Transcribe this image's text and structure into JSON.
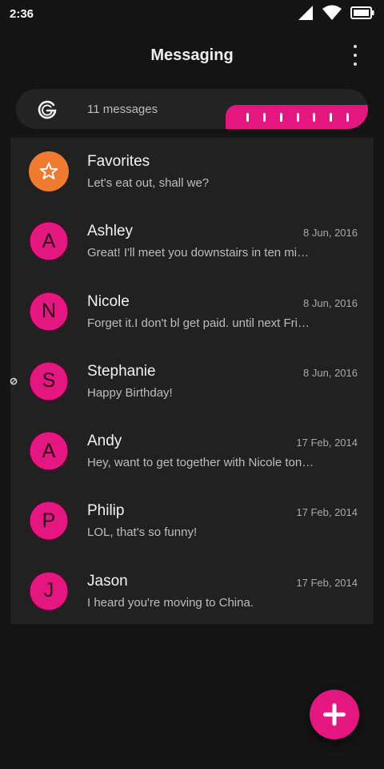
{
  "status_bar": {
    "time": "2:36",
    "icons": [
      "signal-icon",
      "wifi-icon",
      "battery-icon"
    ]
  },
  "app_bar": {
    "title": "Messaging",
    "menu_icon": "more-vert-icon"
  },
  "summary": {
    "icon": "g-logo-icon",
    "count_text": "11 messages"
  },
  "colors": {
    "accent": "#e3177f",
    "favorite": "#f07a30",
    "background": "#141414",
    "list_background": "#212121"
  },
  "conversations": [
    {
      "initial": "",
      "icon": "star-icon",
      "name": "Favorites",
      "date": "",
      "preview": "Let's eat out, shall we?"
    },
    {
      "initial": "A",
      "name": "Ashley",
      "date": "8 Jun, 2016",
      "preview": "Great! I'll meet you downstairs in ten minutes."
    },
    {
      "initial": "N",
      "name": "Nicole",
      "date": "8 Jun, 2016",
      "preview": "Forget it.I don't bl get paid. until next Friday."
    },
    {
      "initial": "S",
      "name": "Stephanie",
      "date": "8 Jun, 2016",
      "preview": "Happy Birthday!"
    },
    {
      "initial": "A",
      "name": "Andy",
      "date": "17 Feb, 2014",
      "preview": "Hey, want to get together with Nicole tonight?"
    },
    {
      "initial": "P",
      "name": "Philip",
      "date": "17 Feb, 2014",
      "preview": "LOL, that's so funny!"
    },
    {
      "initial": "J",
      "name": "Jason",
      "date": "17 Feb, 2014",
      "preview": "I heard you're moving to China."
    }
  ],
  "fab": {
    "icon": "plus-icon"
  }
}
